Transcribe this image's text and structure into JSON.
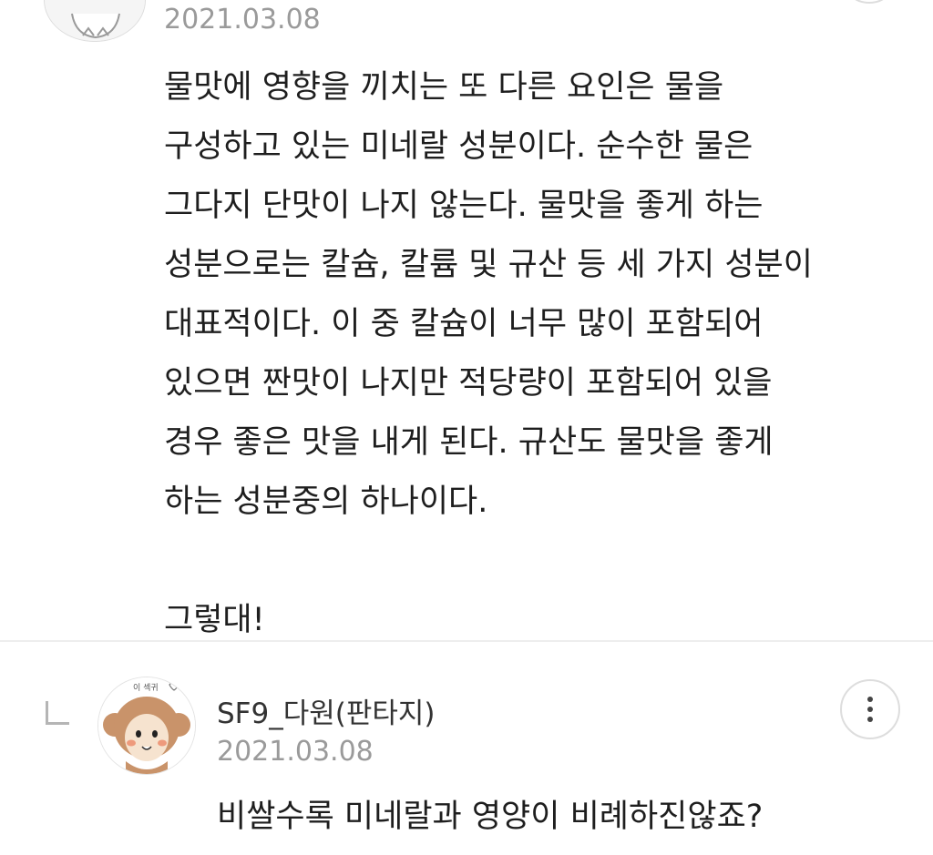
{
  "first_comment": {
    "date": "2021.03.08",
    "paragraph_lines": [
      "물맛에 영향을 끼치는 또 다른 요인은 물을",
      "구성하고 있는 미네랄 성분이다. 순수한 물은",
      "그다지 단맛이 나지 않는다. 물맛을 좋게 하는",
      "성분으로는 칼슘, 칼륨 및 규산 등 세 가지 성분이",
      "대표적이다. 이 중 칼슘이 너무 많이 포함되어",
      "있으면 짠맛이 나지만 적당량이 포함되어 있을",
      "경우 좋은 맛을 내게 된다. 규산도 물맛을 좋게",
      "하는 성분중의 하나이다."
    ],
    "closing": "그렇대!"
  },
  "reply": {
    "avatar_caption": "이 섹귀",
    "author": "SF9_다원(판타지)",
    "date": "2021.03.08",
    "body": "비쌀수록 미네랄과 영양이 비례하진않죠?"
  },
  "colors": {
    "text": "#1e1e1e",
    "meta": "#9a9a9a",
    "divider": "#eeeeee",
    "monkey_fur": "#c9936a",
    "monkey_face": "#f6e3cf"
  },
  "icons": {
    "more": "vertical-ellipsis",
    "reply": "reply-corner-arrow"
  }
}
